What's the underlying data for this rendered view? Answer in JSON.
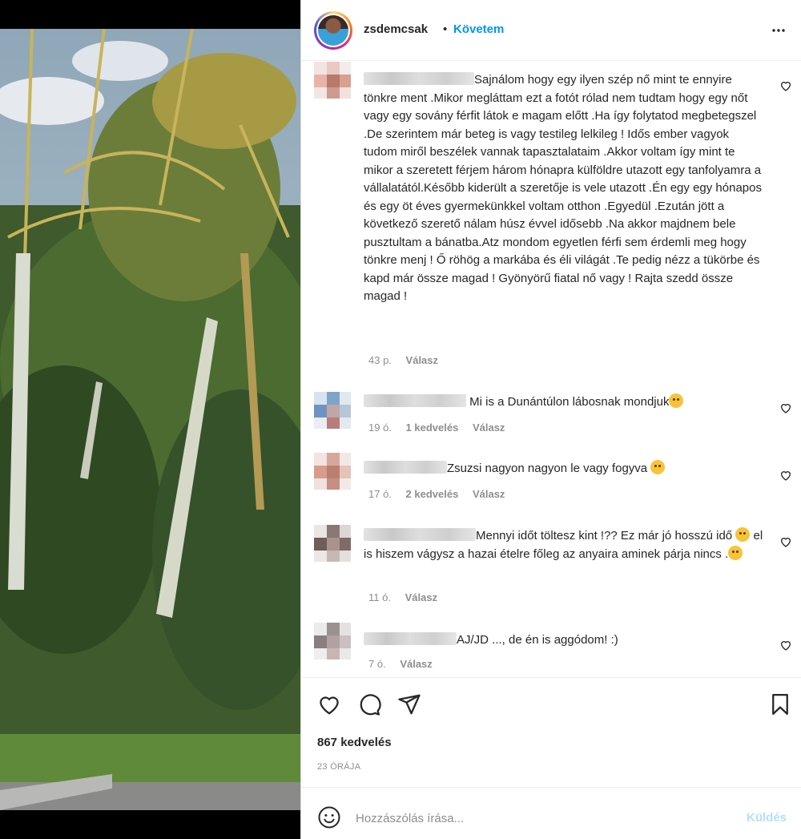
{
  "header": {
    "username": "zsdemcsak",
    "separator": "•",
    "follow_label": "Követem",
    "more_icon": "more-horizontal-icon"
  },
  "comments": [
    {
      "text": "Sajnálom hogy egy ilyen szép nő mint te ennyire tönkre ment .Mikor megláttam ezt a fotót rólad nem tudtam hogy egy nőt vagy egy sovány férfit látok e magam előtt .Ha így folytatod megbetegszel .De szerintem már beteg is vagy testileg lelkileg ! Idős ember vagyok tudom miről beszélek vannak tapasztalataim .Akkor voltam így mint te mikor a szeretett férjem három hónapra külföldre utazott egy tanfolyamra a vállalatától.Később kiderült a szeretője is vele utazott .Én egy egy hónapos és egy öt éves gyermekünkkel voltam otthon .Egyedül .Ezután jött a következő szerető nálam húsz évvel idősebb .Na akkor majdnem bele pusztultam a bánatba.Atz mondom egyetlen férfi sem érdemli meg hogy tönkre menj ! Ő röhög a markába és éli világát .Te pedig nézz a tükörbe és kapd már össze magad ! Gyönyörű fiatal nő vagy ! Rajta szedd össze magad !",
      "time": "43 p.",
      "likes": "",
      "reply": "Válasz"
    },
    {
      "text": "Mi is a Dunántúlon lábosnak mondjuk",
      "time": "19 ó.",
      "likes": "1 kedvelés",
      "reply": "Válasz"
    },
    {
      "text": "Zsuzsi nagyon nagyon le vagy fogyva",
      "time": "17 ó.",
      "likes": "2 kedvelés",
      "reply": "Válasz"
    },
    {
      "text_1": "Mennyi időt töltesz kint !?? Ez már jó hosszú idő",
      "text_2": "el is hiszem vágysz a hazai ételre főleg az anyaira aminek párja nincs .",
      "time": "11 ó.",
      "likes": "",
      "reply": "Válasz"
    },
    {
      "text": "AJ/JD ..., de én is aggódom! :)",
      "time": "7 ó.",
      "likes": "",
      "reply": "Válasz"
    }
  ],
  "actions": {
    "like_icon": "heart-icon",
    "comment_icon": "comment-bubble-icon",
    "share_icon": "paper-plane-icon",
    "save_icon": "bookmark-icon"
  },
  "likes_count": "867 kedvelés",
  "time_ago": "23 ÓRÁJA",
  "composer": {
    "placeholder": "Hozzászólás írása...",
    "post_label": "Küldés"
  },
  "colors": {
    "accent": "#0095f6",
    "post_disabled": "#b2dffc",
    "text": "#262626",
    "secondary": "#8e8e8e"
  }
}
